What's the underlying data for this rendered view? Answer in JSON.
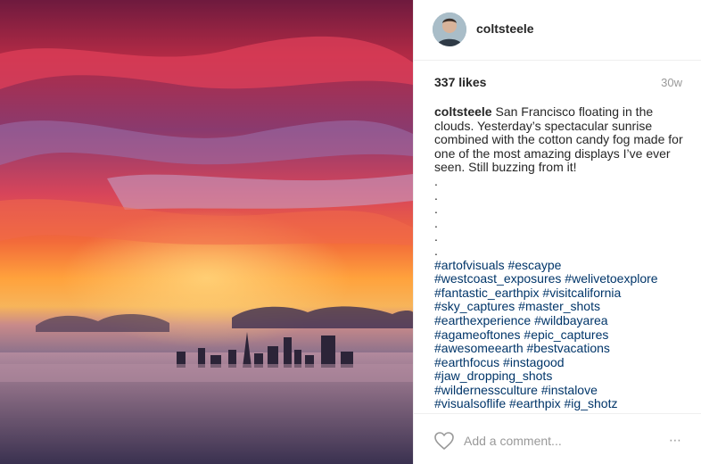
{
  "header": {
    "username": "coltsteele"
  },
  "meta": {
    "likes": "337 likes",
    "age": "30w"
  },
  "caption": {
    "username": "coltsteele",
    "text": "San Francisco floating in the clouds. Yesterday’s spectacular sunrise combined with the cotton candy fog made for one of the most amazing displays I’ve ever seen. Still buzzing from it!",
    "dots": [
      ".",
      ".",
      ".",
      ".",
      ".",
      "."
    ],
    "hashtag_lines": [
      "#artofvisuals #escaype",
      "#westcoast_exposures #welivetoexplore",
      "#fantastic_earthpix #visitcalifornia",
      "#sky_captures #master_shots",
      "#earthexperience #wildbayarea",
      "#agameoftones #epic_captures",
      "#awesomeearth #bestvacations",
      "#earthfocus #instagood",
      "#jaw_dropping_shots",
      "#wildernessculture #instalove",
      "#visualsoflife #earthpix #ig_shotz"
    ]
  },
  "comment": {
    "placeholder": "Add a comment...",
    "more": "⋯"
  },
  "icons": {
    "heart": "heart-icon",
    "more": "more-options-icon"
  },
  "colors": {
    "hashtag": "#003569",
    "muted": "#999999"
  }
}
